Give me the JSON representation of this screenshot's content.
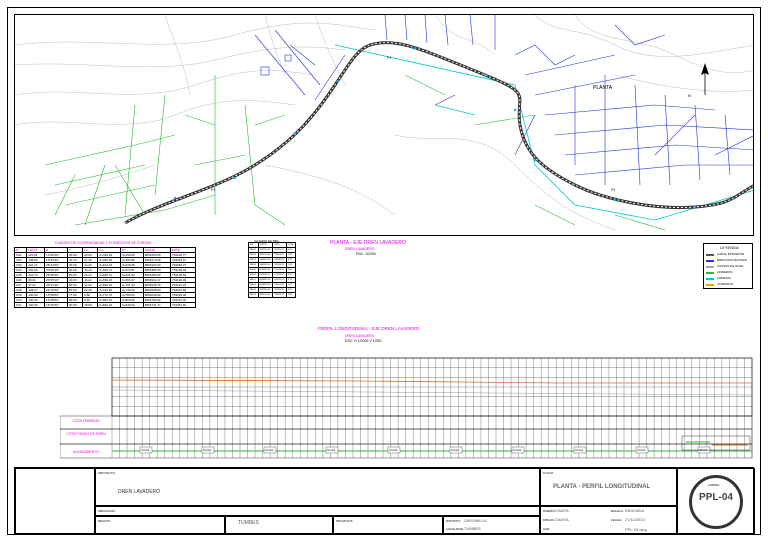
{
  "plan": {
    "label_planta": "PLANTA",
    "north": "N",
    "pi_labels": [
      "PI",
      "PI",
      "PI"
    ]
  },
  "plan_title": {
    "title": "PLANTA - EJE DREN LAVADERO",
    "subtitle": "DREN LAVADERO",
    "scale": "ESC: 1/2000"
  },
  "profile_title": {
    "title": "PERFIL LONGITUDINAL - EJE DREN LAVADERO",
    "subtitle": "DREN LAVADERO",
    "scale": "ESC: H 1/2000 V 1/250"
  },
  "coord_table": {
    "title": "CUADRO DE COORDENADAS Y ELEMENTOS DE CURVAS",
    "headers": [
      "PI",
      "DELTA",
      "R",
      "T",
      "LC",
      "PC",
      "PT",
      "NORTE",
      "ESTE"
    ],
    "rows": [
      [
        "C01",
        "115.28",
        "13°06'20\"",
        "30.00",
        "20.00",
        "0+420.24",
        "0+430.00",
        "8654200.00",
        "763220.77"
      ],
      [
        "C02",
        "198.89",
        "15°43'30\"",
        "40.10",
        "21.30",
        "0+455.45",
        "0+495.80",
        "8654270.68",
        "763044.67"
      ],
      [
        "C03",
        "201.21",
        "25°14'00\"",
        "30.00",
        "14.20",
        "0+524.15",
        "0+538.35",
        "8654320.00",
        "763084.27"
      ],
      [
        "C04",
        "100.00",
        "20°05'10\"",
        "20.00",
        "13.10",
        "0+560.71",
        "0+573.81",
        "8654385.00",
        "763106.93"
      ],
      [
        "C05",
        "210.73",
        "38°08'40\"",
        "60.00",
        "26.21",
        "0+605.71",
        "0+631.92",
        "8654460.00",
        "763148.59"
      ],
      [
        "C06",
        "89.61",
        "20°05'10\"",
        "30.00",
        "16.22",
        "0+650.15",
        "0+666.37",
        "8654502.17",
        "763190.06"
      ],
      [
        "C07",
        "57.21",
        "35°21'40\"",
        "50.00",
        "11.22",
        "0+690.22",
        "0+701.44",
        "8654545.76",
        "763221.24"
      ],
      [
        "C08",
        "109.27",
        "22°16'50\"",
        "80.00",
        "22.30",
        "0+724.20",
        "0+746.50",
        "8654608.00",
        "763251.89"
      ],
      [
        "C09",
        "100.00",
        "15°08'50\"",
        "77.00",
        "9.80",
        "0+770.72",
        "0+780.52",
        "8654640.00",
        "763293.30"
      ],
      [
        "C10",
        "100.00",
        "15°08'50\"",
        "50.00",
        "9.40",
        "0+800.10",
        "0+809.50",
        "8654700.52",
        "763324.78"
      ],
      [
        "C11",
        "100.00",
        "16°29'30\"",
        "30.00",
        "18.80",
        "0+830.22",
        "0+849.02",
        "8654741.77",
        "763351.66"
      ]
    ]
  },
  "bm_table": {
    "title": "CUADRO DE BMs",
    "headers": [
      "BM",
      "NORTE",
      "ESTE",
      "COTA"
    ],
    "rows": [
      [
        "BM-01",
        "8654200.00",
        "763220.77",
        "5.20"
      ],
      [
        "BM-02",
        "8654270.68",
        "763044.67",
        "5.35"
      ],
      [
        "BM-03",
        "8654320.00",
        "763084.27",
        "5.41"
      ],
      [
        "BM-04",
        "8654385.00",
        "763106.93",
        "5.48"
      ],
      [
        "BM-05",
        "8654460.00",
        "763148.59",
        "5.50"
      ],
      [
        "BM-06",
        "8654502.17",
        "763190.06",
        "5.62"
      ],
      [
        "BM-07",
        "8654545.76",
        "763221.24",
        "5.70"
      ],
      [
        "BM-08",
        "8654608.00",
        "763251.89",
        "5.76"
      ],
      [
        "BM-09",
        "8654640.00",
        "763293.30",
        "5.81"
      ],
      [
        "BM-10",
        "8654700.52",
        "763324.78",
        "5.88"
      ]
    ]
  },
  "legend": {
    "title": "LEYENDA",
    "items": [
      "CANAL EXISTENTE",
      "DREN PROYECTADO",
      "CURVAS DE NIVEL",
      "LINDEROS",
      "CAMINOS",
      "VIVIENDAS"
    ]
  },
  "profile": {
    "row_labels": [
      "COTA TERRENO",
      "COTA FONDO DE DREN",
      "ALINEAMIENTO"
    ],
    "curve_label": "Curva"
  },
  "title_block": {
    "proyecto_label": "PROYECTO:",
    "proyecto_value": "DREN LAVADERO",
    "ubicacion_label": "UBICACION:",
    "region_label": "REGION:",
    "region_value": "TUMBES",
    "provincia_label": "PROVINCIA:",
    "distrito_label": "DISTRITO:",
    "distrito_value": "ZARUMILLA",
    "localidad_label": "LOCALIDAD:",
    "localidad_value": "TUMBES",
    "plano_label": "PLANO:",
    "plano_title": "PLANTA - PERFIL LONGITUDINAL",
    "escala_label": "ESCALA:",
    "escala_value": "INDICADA",
    "fecha_label": "FECHA:",
    "fecha_value": "27/11/2023",
    "diseno_label": "DISEÑO:",
    "diseno_value": "CAMTA",
    "dibujo_label": "DIBUJO:",
    "dibujo_value": "CAMTA",
    "lamina_label": "LAMINA:",
    "sheet_code": "PPL-04",
    "cad_label": "CAD:",
    "cad_value": "PPL-04.dwg"
  }
}
